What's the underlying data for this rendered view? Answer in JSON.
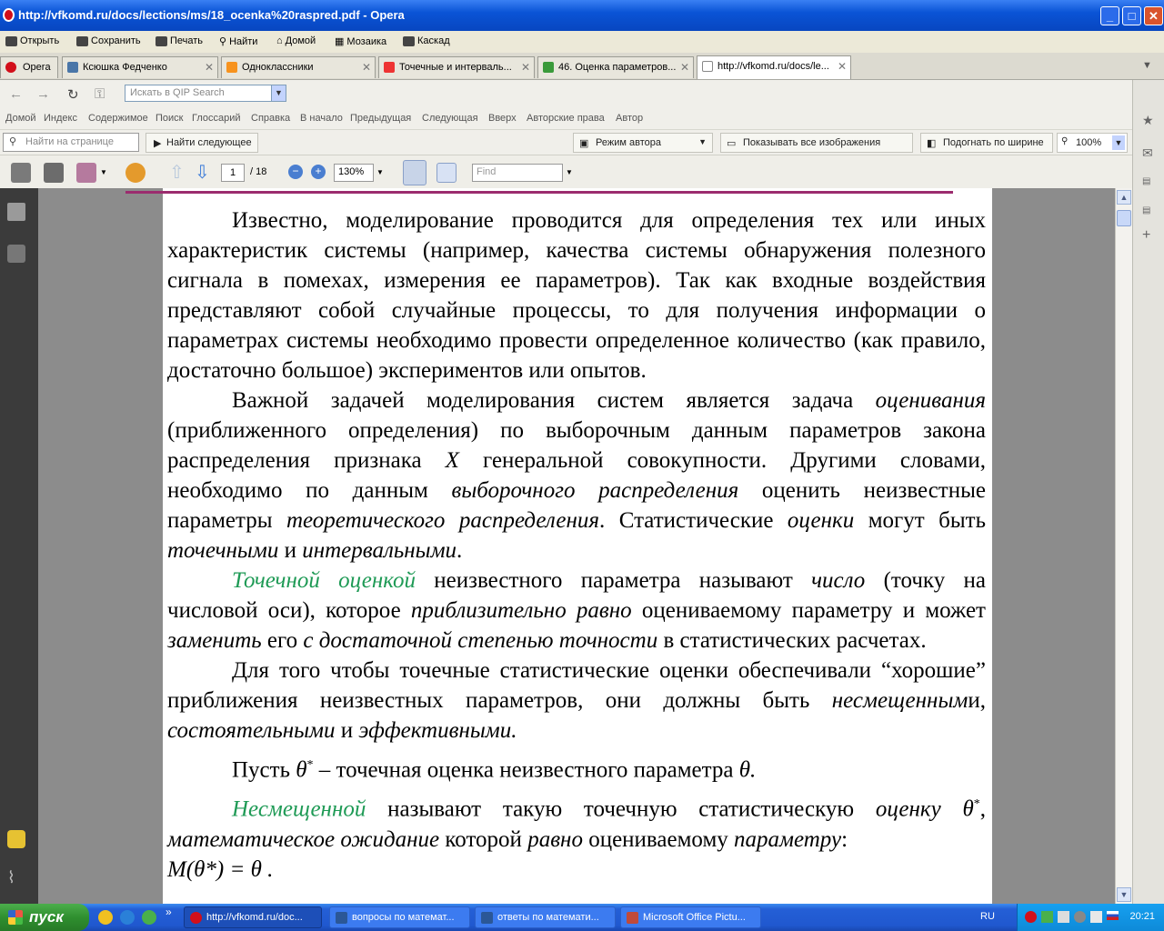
{
  "window": {
    "title": "http://vfkomd.ru/docs/lections/ms/18_ocenka%20raspred.pdf - Opera"
  },
  "menu": [
    "Открыть",
    "Сохранить",
    "Печать",
    "Найти",
    "Домой",
    "Мозаика",
    "Каскад"
  ],
  "tabs": [
    {
      "label": "Opera"
    },
    {
      "label": "Ксюшка Федченко"
    },
    {
      "label": "Одноклассники"
    },
    {
      "label": "Точечные и интерваль..."
    },
    {
      "label": "46. Оценка параметров..."
    },
    {
      "label": "http://vfkomd.ru/docs/le..."
    }
  ],
  "addressbar": {
    "search_placeholder": "Искать в QIP Search"
  },
  "navlinks": [
    "Домой",
    "Индекс",
    "Содержимое",
    "Поиск",
    "Глоссарий",
    "Справка",
    "В начало",
    "Предыдущая",
    "Следующая",
    "Вверх",
    "Авторские права",
    "Автор"
  ],
  "pdfbar": {
    "find_placeholder": "Найти на странице",
    "find_next": "Найти следующее",
    "author_mode": "Режим автора",
    "show_images": "Показывать все изображения",
    "fit_width": "Подогнать по ширине",
    "zoom_percent": "100%"
  },
  "reader": {
    "page_current": "1",
    "page_total": "/ 18",
    "zoom": "130%",
    "find_placeholder": "Find"
  },
  "document": {
    "p1": "Известно, моделирование проводится для определения тех или иных характеристик системы (например, качества системы обнаружения полезного сигнала в помехах, измерения ее параметров). Так как входные воздействия представляют собой случайные процессы, то для получения информации о параметрах системы необходимо провести определенное количество (как правило, достаточно большое) экспериментов или опытов.",
    "p2": {
      "a": "Важной задачей моделирования систем является задача ",
      "b": "оценивания",
      "c": " (приближенного определения) по выборочным данным параметров закона распределения признака ",
      "d": "X",
      "e": " генеральной совокупности. Другими словами, необходимо по данным ",
      "f": "выборочного распределения",
      "g": " оценить неизвестные параметры ",
      "h": "теоретического распределения",
      "i": ". Статистические ",
      "j": "оценки",
      "k": " могут быть ",
      "l": "точечными",
      "m": " и ",
      "n": "интервальными",
      "o": "."
    },
    "p3": {
      "a": "Точечной оценкой",
      "b": " неизвестного параметра называют ",
      "c": "число",
      "d": " (точку на числовой оси), которое ",
      "e": "приблизительно равно",
      "f": " оцениваемому параметру и может ",
      "g": "заменить",
      "h": " его ",
      "i": "с достаточной степенью точности",
      "j": " в статистических расчетах."
    },
    "p4": {
      "a": "Для того чтобы точечные статистические оценки обеспечивали “хорошие” приближения неизвестных параметров, они должны быть ",
      "b": "несмещенным",
      "c": "и, ",
      "d": "состоятельными",
      "e": " и ",
      "f": "эффективными."
    },
    "p5": {
      "a": "Пусть ",
      "b": "θ",
      "c": "*",
      "d": " – точечная оценка неизвестного параметра ",
      "e": "θ."
    },
    "p6": {
      "a": "Несмещенной",
      "b": " называют такую точечную статистическую ",
      "c": "оценку",
      "d": " θ",
      "e": "*",
      "f": ", ",
      "g": "математическое ожидание",
      "h": " которой ",
      "i": "равно",
      "j": " оцениваемому ",
      "k": "параметру",
      "l": ":"
    },
    "formula": "M(θ*) = θ ."
  },
  "taskbar": {
    "start": "пуск",
    "tasks": [
      "http://vfkomd.ru/doc...",
      "вопросы по математ...",
      "ответы по математи...",
      "Microsoft Office Pictu..."
    ],
    "lang": "RU",
    "clock": "20:21"
  },
  "colors": {
    "accent_green": "#1e9a55",
    "rule": "#9b2c6e",
    "titlebar": "#0a54d6"
  }
}
